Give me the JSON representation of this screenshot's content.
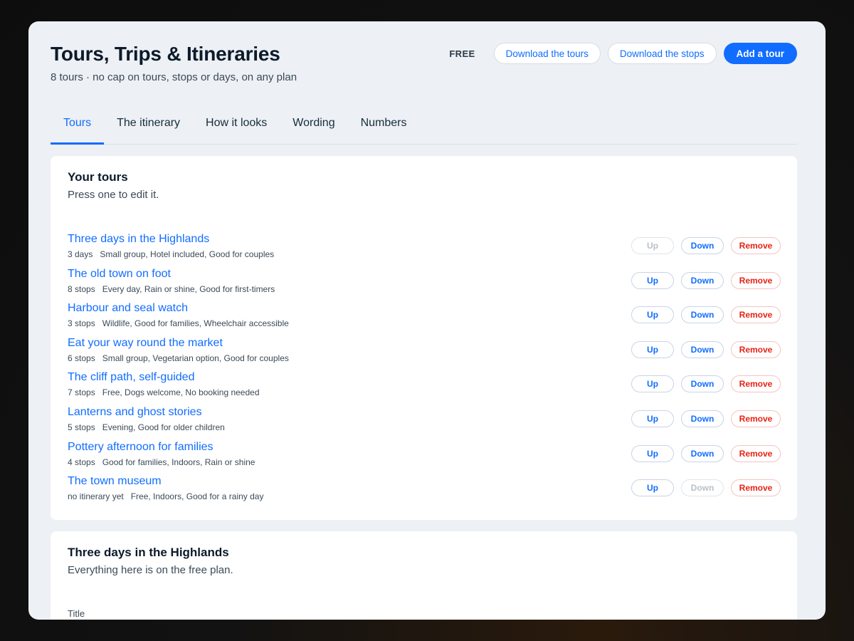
{
  "header": {
    "title": "Tours, Trips & Itineraries",
    "subtitle": "8 tours · no cap on tours, stops or days, on any plan",
    "plan_badge": "FREE",
    "download_tours_label": "Download the tours",
    "download_stops_label": "Download the stops",
    "add_tour_label": "Add a tour"
  },
  "tabs": [
    {
      "label": "Tours",
      "active": true
    },
    {
      "label": "The itinerary",
      "active": false
    },
    {
      "label": "How it looks",
      "active": false
    },
    {
      "label": "Wording",
      "active": false
    },
    {
      "label": "Numbers",
      "active": false
    }
  ],
  "tours_card": {
    "title": "Your tours",
    "subtitle": "Press one to edit it.",
    "up_label": "Up",
    "down_label": "Down",
    "remove_label": "Remove",
    "tours": [
      {
        "name": "Three days in the Highlands",
        "count": "3 days",
        "tags": "Small group, Hotel included, Good for couples",
        "up_enabled": false,
        "down_enabled": true
      },
      {
        "name": "The old town on foot",
        "count": "8 stops",
        "tags": "Every day, Rain or shine, Good for first-timers",
        "up_enabled": true,
        "down_enabled": true
      },
      {
        "name": "Harbour and seal watch",
        "count": "3 stops",
        "tags": "Wildlife, Good for families, Wheelchair accessible",
        "up_enabled": true,
        "down_enabled": true
      },
      {
        "name": "Eat your way round the market",
        "count": "6 stops",
        "tags": "Small group, Vegetarian option, Good for couples",
        "up_enabled": true,
        "down_enabled": true
      },
      {
        "name": "The cliff path, self-guided",
        "count": "7 stops",
        "tags": "Free, Dogs welcome, No booking needed",
        "up_enabled": true,
        "down_enabled": true
      },
      {
        "name": "Lanterns and ghost stories",
        "count": "5 stops",
        "tags": "Evening, Good for older children",
        "up_enabled": true,
        "down_enabled": true
      },
      {
        "name": "Pottery afternoon for families",
        "count": "4 stops",
        "tags": "Good for families, Indoors, Rain or shine",
        "up_enabled": true,
        "down_enabled": true
      },
      {
        "name": "The town museum",
        "count": "no itinerary yet",
        "tags": "Free, Indoors, Good for a rainy day",
        "up_enabled": true,
        "down_enabled": false
      }
    ]
  },
  "editor_card": {
    "title": "Three days in the Highlands",
    "subtitle": "Everything here is on the free plan.",
    "field_label": "Title"
  },
  "colors": {
    "accent": "#116dff",
    "danger": "#e62214",
    "background": "#edf0f4"
  }
}
